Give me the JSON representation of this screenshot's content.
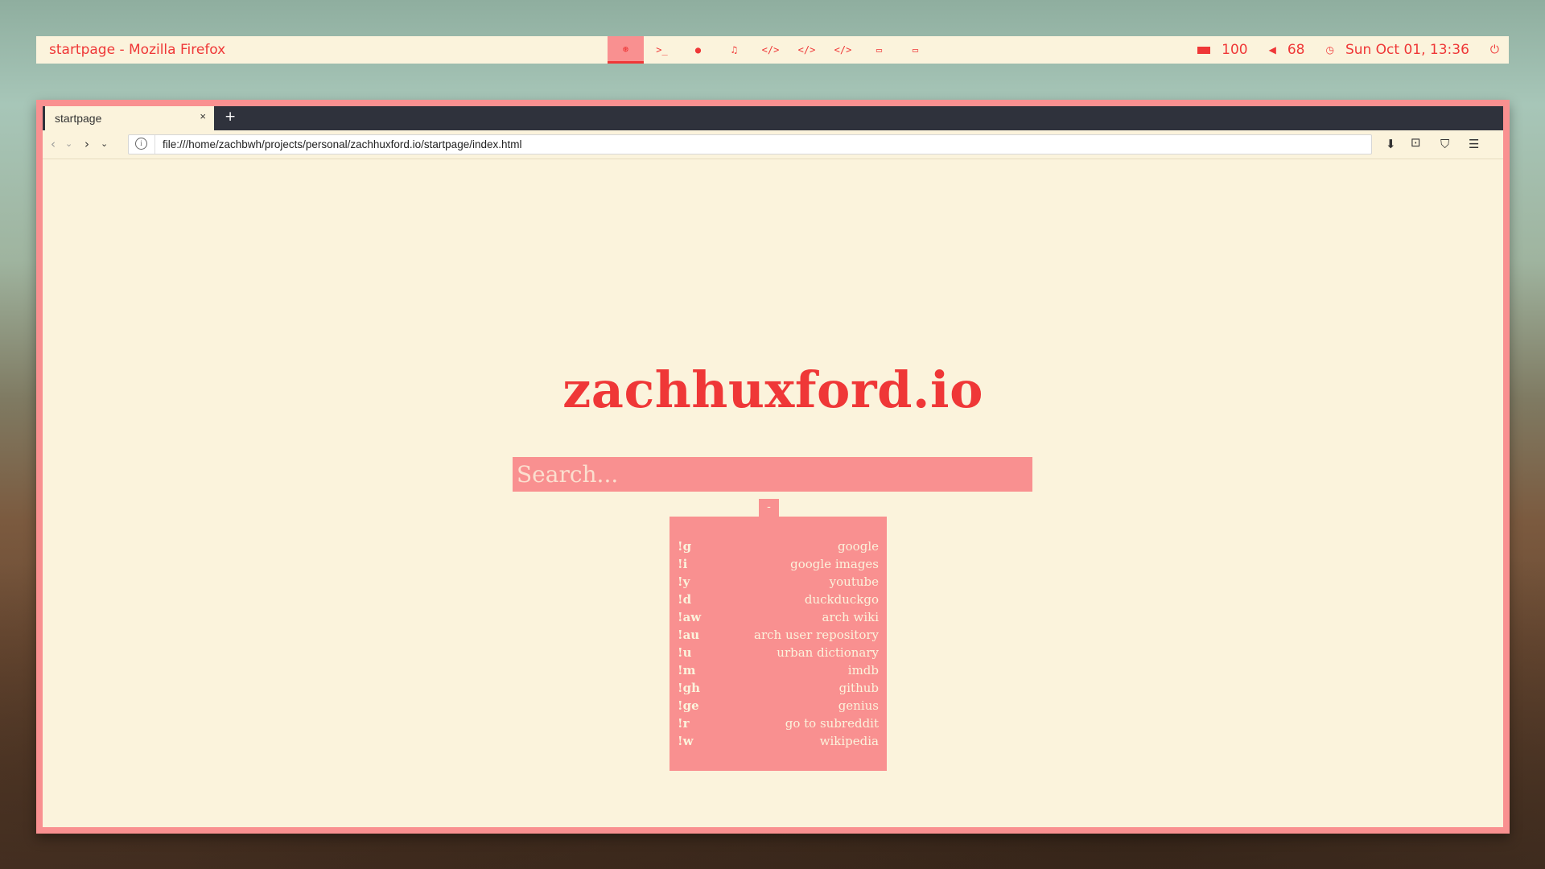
{
  "panel": {
    "window_title": "startpage - Mozilla Firefox",
    "workspaces": [
      {
        "icon": "chrome-icon",
        "glyph": "⊛"
      },
      {
        "icon": "terminal-icon",
        "glyph": ">_"
      },
      {
        "icon": "chat-icon",
        "glyph": "●"
      },
      {
        "icon": "music-icon",
        "glyph": "♫"
      },
      {
        "icon": "code-icon",
        "glyph": "</>"
      },
      {
        "icon": "code-icon",
        "glyph": "</>"
      },
      {
        "icon": "code-icon",
        "glyph": "</>"
      },
      {
        "icon": "monitor-icon",
        "glyph": "▭"
      },
      {
        "icon": "monitor-icon",
        "glyph": "▭"
      }
    ],
    "battery": "100",
    "volume": "68",
    "clock": "Sun Oct 01, 13:36"
  },
  "browser": {
    "tab_label": "startpage",
    "tab_close": "×",
    "new_tab": "+",
    "url": "file:///home/zachbwh/projects/personal/zachhuxford.io/startpage/index.html"
  },
  "page": {
    "title": "zachhuxford.io",
    "search_placeholder": "Search...",
    "toggle_label": "-",
    "bangs": [
      {
        "key": "!g",
        "name": "google"
      },
      {
        "key": "!i",
        "name": "google images"
      },
      {
        "key": "!y",
        "name": "youtube"
      },
      {
        "key": "!d",
        "name": "duckduckgo"
      },
      {
        "key": "!aw",
        "name": "arch wiki"
      },
      {
        "key": "!au",
        "name": "arch user repository"
      },
      {
        "key": "!u",
        "name": "urban dictionary"
      },
      {
        "key": "!m",
        "name": "imdb"
      },
      {
        "key": "!gh",
        "name": "github"
      },
      {
        "key": "!ge",
        "name": "genius"
      },
      {
        "key": "!r",
        "name": "go to subreddit"
      },
      {
        "key": "!w",
        "name": "wikipedia"
      }
    ]
  },
  "colors": {
    "accent": "#ef3737",
    "pink": "#f99090",
    "cream": "#fbf3dc",
    "tabbar": "#2f323c"
  }
}
